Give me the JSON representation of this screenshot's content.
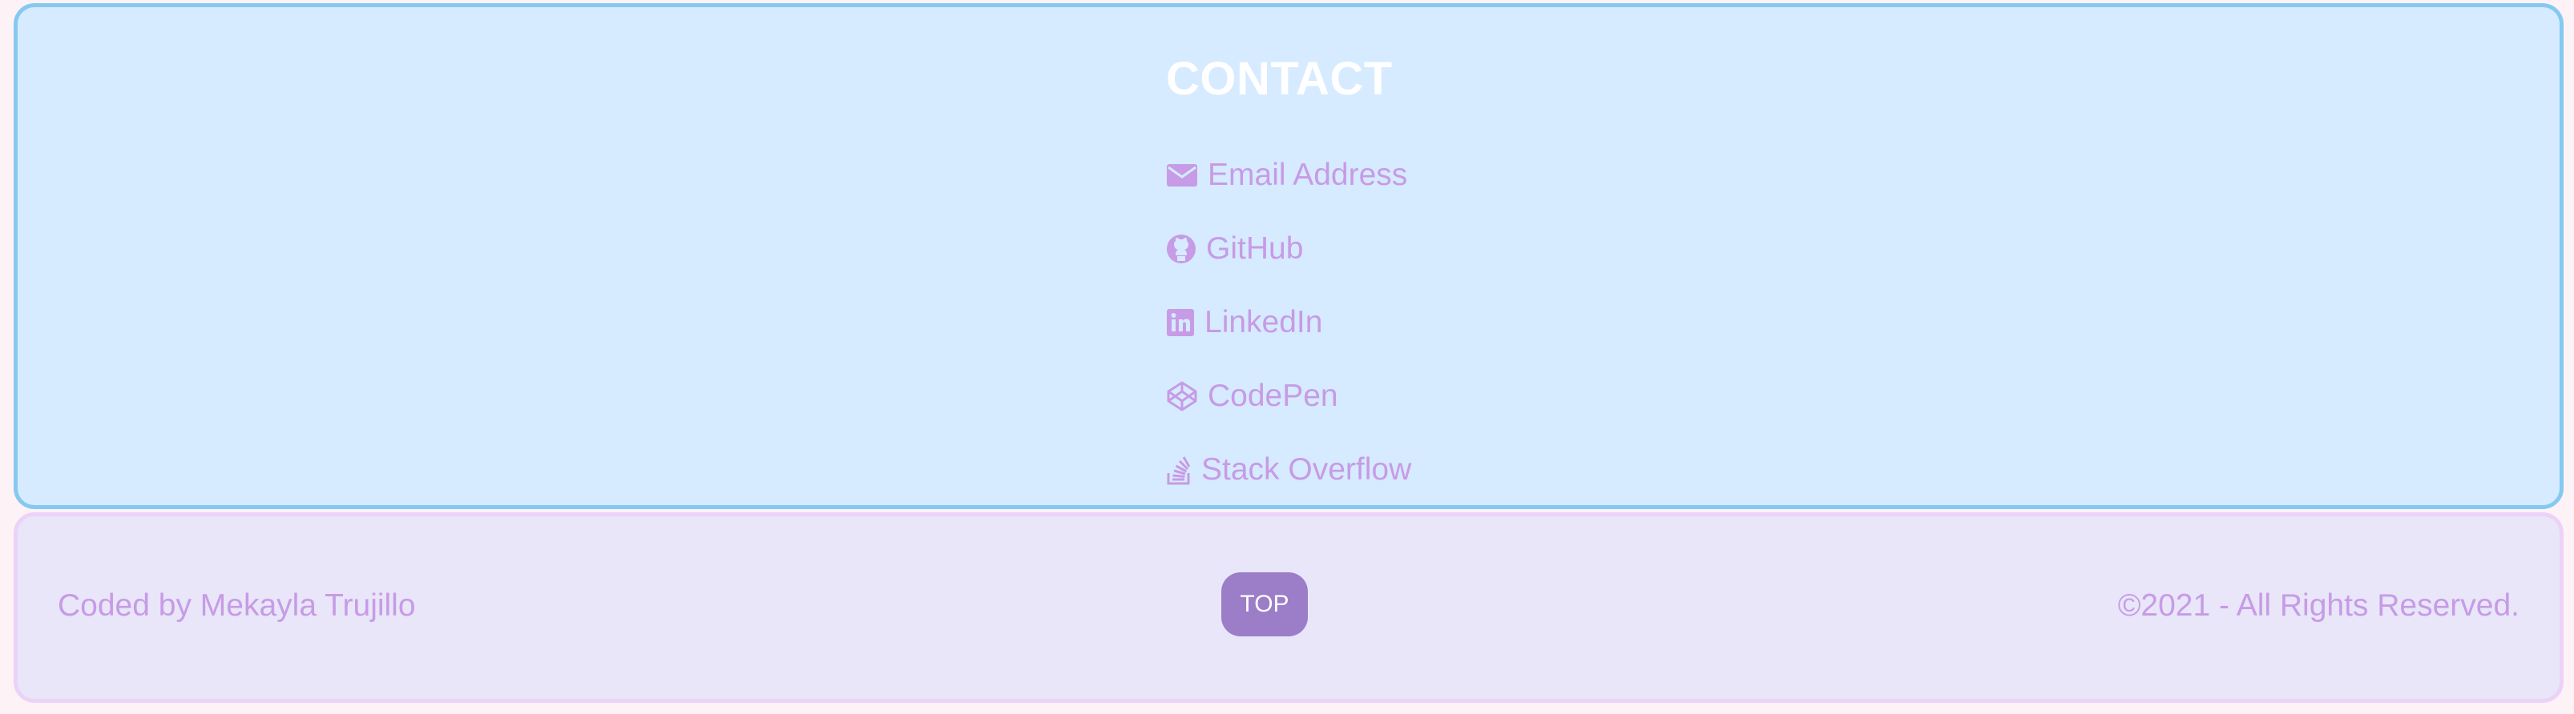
{
  "contact": {
    "title": "CONTACT",
    "links": [
      {
        "label": "Email Address",
        "icon": "envelope-icon"
      },
      {
        "label": "GitHub",
        "icon": "github-icon"
      },
      {
        "label": "LinkedIn",
        "icon": "linkedin-icon"
      },
      {
        "label": "CodePen",
        "icon": "codepen-icon"
      },
      {
        "label": "Stack Overflow",
        "icon": "stack-overflow-icon"
      }
    ]
  },
  "footer": {
    "credit": "Coded by Mekayla Trujillo",
    "top_button": "TOP",
    "copyright": "©2021 - All Rights Reserved."
  },
  "colors": {
    "page_background": "#fdf2f6",
    "contact_background": "#d6ebff",
    "contact_border": "#86c9f0",
    "footer_background": "#e8e6f8",
    "footer_border": "#ecd2f8",
    "link_text": "#c79be6",
    "title_text": "#ffffff",
    "top_button_background": "#9b7dc8"
  }
}
